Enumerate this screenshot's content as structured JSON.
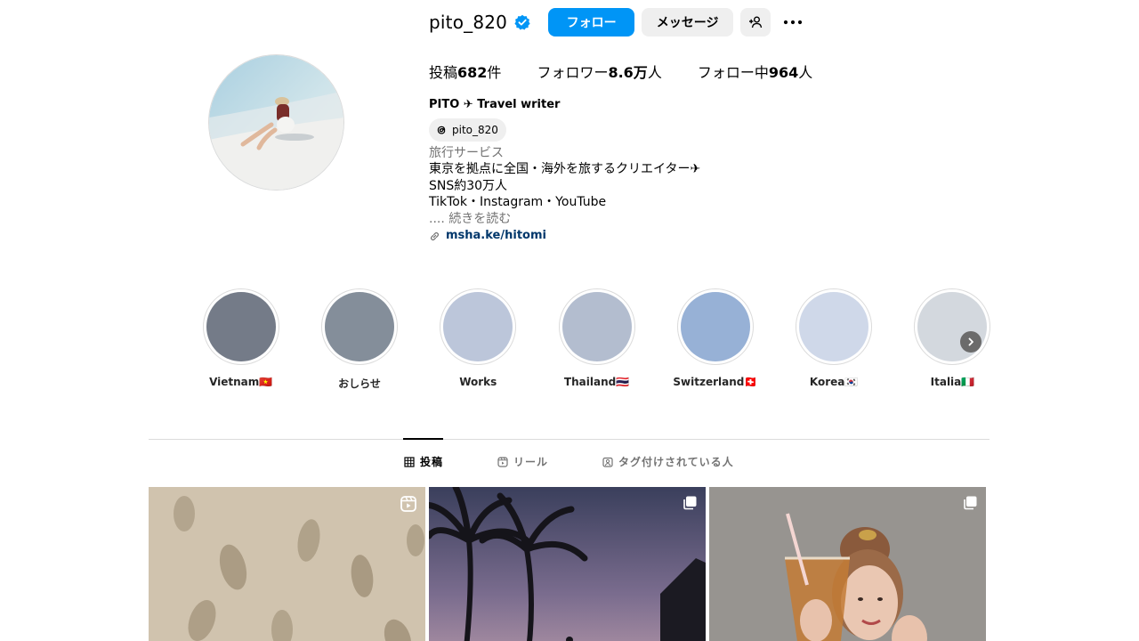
{
  "profile": {
    "username": "pito_820",
    "verified": true,
    "follow_label": "フォロー",
    "message_label": "メッセージ",
    "stats": {
      "posts_prefix": "投稿",
      "posts_value": "682",
      "posts_suffix": "件",
      "followers_prefix": "フォロワー",
      "followers_value": "8.6万",
      "followers_suffix": "人",
      "following_prefix": "フォロー中",
      "following_value": "964",
      "following_suffix": "人"
    },
    "display_name": "PITO ✈ Travel writer",
    "threads_handle": "pito_820",
    "category": "旅行サービス",
    "bio_lines": [
      "東京を拠点に全国・海外を旅するクリエイター✈",
      "SNS約30万人",
      "TikTok・Instagram・YouTube"
    ],
    "bio_more_prefix": "....",
    "bio_more": "続きを読む",
    "link": "msha.ke/hitomi"
  },
  "highlights": [
    {
      "label": "Vietnam🇻🇳",
      "color": "#747b88"
    },
    {
      "label": "おしらせ",
      "color": "#848e9a"
    },
    {
      "label": "Works",
      "color": "#bcc6da"
    },
    {
      "label": "Thailand🇹🇭",
      "color": "#b3bdcf"
    },
    {
      "label": "Switzerland🇨🇭",
      "color": "#97b1d6"
    },
    {
      "label": "Korea🇰🇷",
      "color": "#cfd8e9"
    },
    {
      "label": "Italia🇮🇹",
      "color": "#d3d8de"
    }
  ],
  "tabs": [
    {
      "label": "投稿",
      "icon": "grid-icon",
      "active": true
    },
    {
      "label": "リール",
      "icon": "reels-icon",
      "active": false
    },
    {
      "label": "タグ付けされている人",
      "icon": "tagged-icon",
      "active": false
    }
  ],
  "posts": [
    {
      "scene": "footprints-in-sand",
      "badge": "reels-icon"
    },
    {
      "scene": "palm-trees-at-dusk",
      "badge": "carousel-icon"
    },
    {
      "scene": "woman-with-iced-tea",
      "badge": "carousel-icon"
    }
  ],
  "colors": {
    "accent": "#0095f6",
    "button_gray": "#efefef",
    "link": "#00376b",
    "muted_text": "#737373",
    "verified": "#0095f6"
  }
}
